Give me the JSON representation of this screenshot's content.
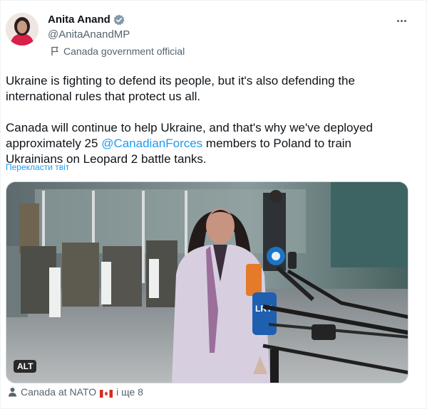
{
  "author": {
    "name": "Anita Anand",
    "handle": "@AnitaAnandMP",
    "affiliation": "Canada government official",
    "verified_color": "#829aab"
  },
  "tweet": {
    "paragraph1": "Ukraine is fighting to defend its people, but it's also defending the international rules that protect us all.",
    "paragraph2_before": "Canada will continue to help Ukraine, and that's why we've deployed approximately 25 ",
    "mention": "@CanadianForces",
    "paragraph2_after": " members to Poland to train Ukrainians on Leopard 2 battle tanks.",
    "translate_link": "Перекласти твіт"
  },
  "media": {
    "alt_badge": "ALT",
    "microphone_label": "LRT"
  },
  "tagged": {
    "prefix": "Canada at NATO",
    "suffix": "і ще 8"
  },
  "icons": {
    "verified": "verified-badge-icon",
    "affiliation": "flag-icon",
    "more": "more-options-icon",
    "tagged": "person-icon",
    "canada_flag": "canada-flag-icon"
  },
  "colors": {
    "link": "#1d9bf0",
    "secondary_text": "#536471",
    "primary_text": "#0f1419"
  }
}
